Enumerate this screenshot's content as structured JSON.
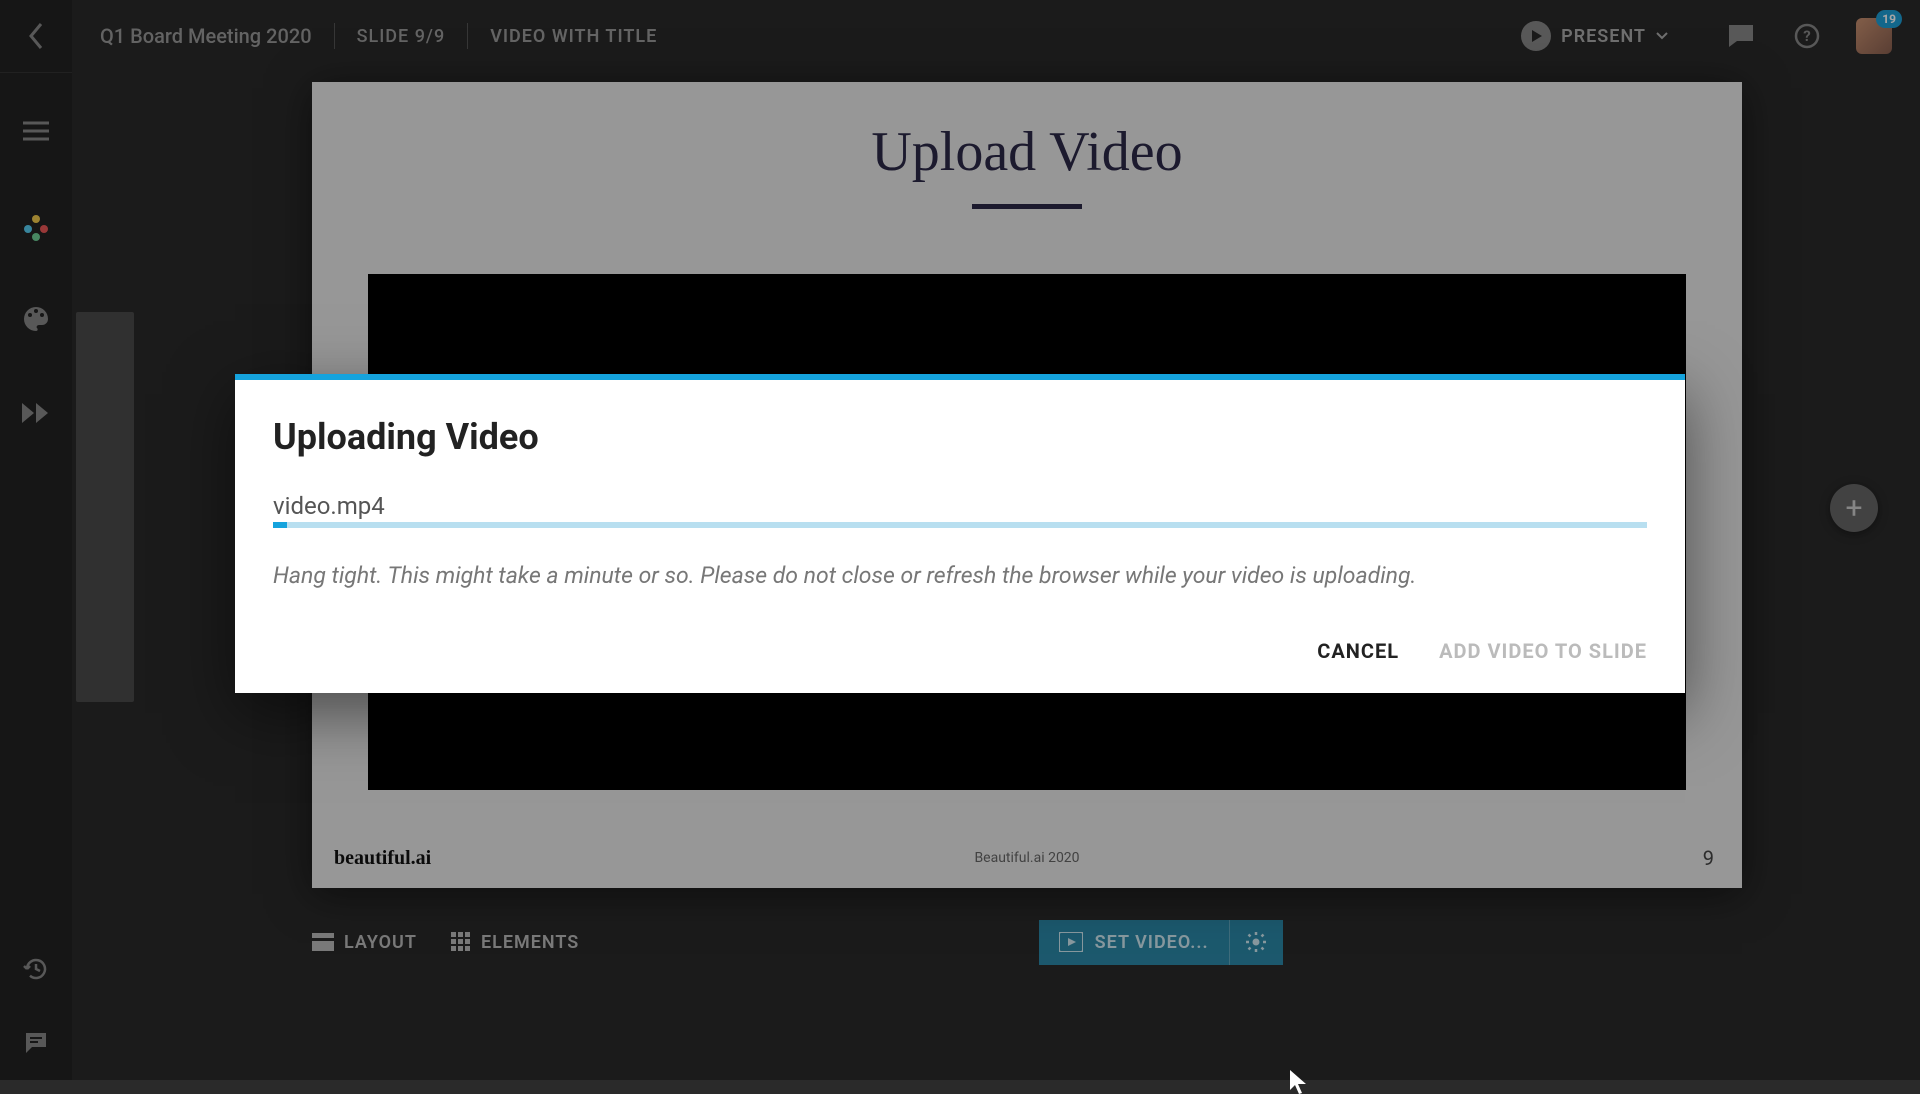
{
  "header": {
    "presentation_name": "Q1 Board Meeting 2020",
    "slide_indicator": "SLIDE 9/9",
    "slide_type": "VIDEO WITH TITLE",
    "present_label": "PRESENT",
    "notification_count": "19"
  },
  "slide": {
    "title": "Upload Video",
    "brand": "beautiful.ai",
    "footer": "Beautiful.ai 2020",
    "number": "9"
  },
  "toolbar": {
    "layout_label": "LAYOUT",
    "elements_label": "ELEMENTS",
    "set_video_label": "SET VIDEO..."
  },
  "modal": {
    "title": "Uploading Video",
    "filename": "video.mp4",
    "hint": "Hang tight. This might take a minute or so. Please do not close or refresh the browser while your video is uploading.",
    "cancel_label": "CANCEL",
    "confirm_label": "ADD VIDEO TO SLIDE",
    "progress_percent": 1
  }
}
